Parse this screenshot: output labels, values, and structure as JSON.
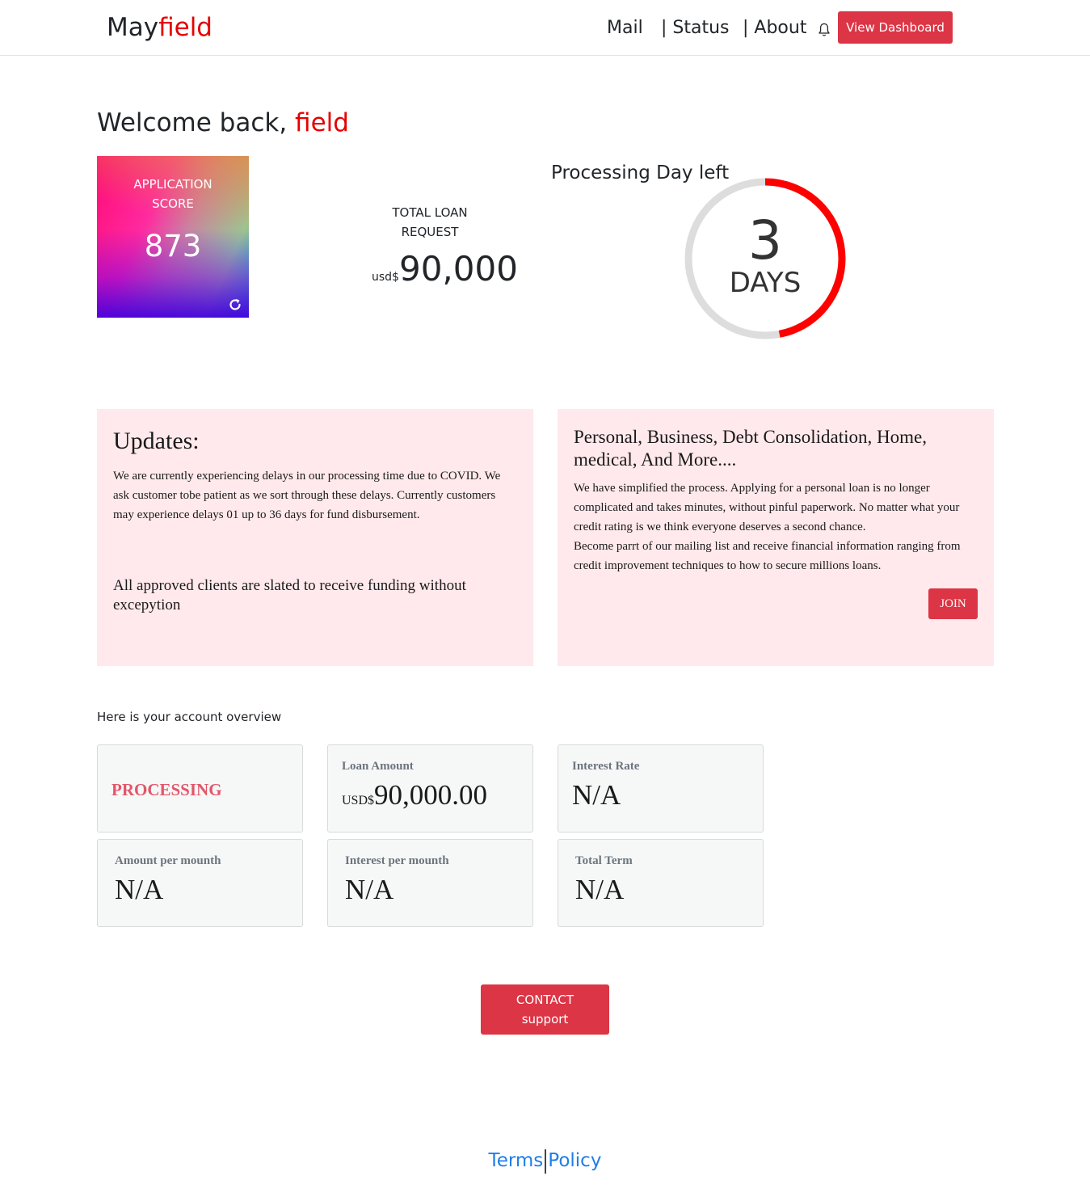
{
  "colors": {
    "accent": "#e60000",
    "button": "#dc3545",
    "panel_bg": "#ffe9ec",
    "status": "#e2566a",
    "ring_progress": "#ff0000",
    "ring_track": "#dddddd",
    "link": "#1e7ee8"
  },
  "header": {
    "brand_prefix": "May",
    "brand_accent": "field",
    "nav": [
      "Mail",
      "| Status",
      "| About"
    ],
    "bell_icon": "bell-icon",
    "dashboard_button": "View Dashboard"
  },
  "welcome": {
    "prefix": "Welcome back, ",
    "name": "field"
  },
  "score": {
    "label_line1": "APPLICATION",
    "label_line2": "SCORE",
    "value": "873",
    "refresh_icon": "refresh-icon"
  },
  "total_loan": {
    "label_line1": "TOTAL LOAN",
    "label_line2": "REQUEST",
    "currency": "usd$",
    "amount": "90,000"
  },
  "processing": {
    "title": "Processing Day left",
    "days": "3",
    "unit": "DAYS",
    "progress_fraction": 0.47
  },
  "updates": {
    "title": "Updates:",
    "body": "We are currently experiencing delays in our processing time due to COVID. We ask customer tobe patient as we sort through these delays. Currently customers may experience delays 01 up to 36 days for fund disbursement.",
    "note": "All approved clients are slated to receive funding without excepytion"
  },
  "promo": {
    "title": "Personal, Business, Debt Consolidation, Home, medical, And More....",
    "body_line1": "We have simplified the process. Applying for a personal loan is no longer complicated and takes minutes, without pinful paperwork. No matter what your credit rating is we think everyone deserves a second chance.",
    "body_line2": "Become parrt of our mailing list and receive financial information ranging from credit improvement techniques to how to secure millions loans.",
    "join_button": "JOIN"
  },
  "overview": {
    "intro": "Here is your account overview",
    "status": "PROCESSING",
    "loan_amount": {
      "label": "Loan Amount",
      "currency": "USD$",
      "value": "90,000.00"
    },
    "interest_rate": {
      "label": "Interest Rate",
      "value": "N/A"
    },
    "amount_per_month": {
      "label": "Amount per mounth",
      "value": "N/A"
    },
    "interest_per_month": {
      "label": "Interest per mounth",
      "value": "N/A"
    },
    "total_term": {
      "label": "Total Term",
      "value": "N/A"
    }
  },
  "contact": {
    "line1": "CONTACT",
    "line2": "support"
  },
  "footer": {
    "terms": "Terms",
    "policy": "Policy"
  }
}
